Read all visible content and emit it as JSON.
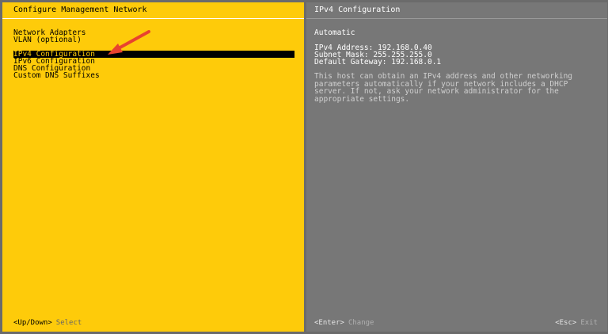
{
  "left_panel": {
    "title": "Configure Management Network",
    "menu_items": [
      {
        "label": "Network Adapters"
      },
      {
        "label": "VLAN (optional)"
      },
      {
        "label": "IPv4 Configuration"
      },
      {
        "label": "IPv6 Configuration"
      },
      {
        "label": "DNS Configuration"
      },
      {
        "label": "Custom DNS Suffixes"
      }
    ],
    "footer": {
      "key": "<Up/Down>",
      "action": "Select"
    }
  },
  "right_panel": {
    "title": "IPv4 Configuration",
    "mode": "Automatic",
    "ipv4_address": "IPv4 Address: 192.168.0.40",
    "subnet_mask": "Subnet Mask: 255.255.255.0",
    "default_gateway": "Default Gateway: 192.168.0.1",
    "description": "This host can obtain an IPv4 address and other networking\nparameters automatically if your network includes a DHCP\nserver. If not, ask your network administrator for the\nappropriate settings.",
    "footer_change": {
      "key": "<Enter>",
      "action": "Change"
    },
    "footer_exit": {
      "key": "<Esc>",
      "action": "Exit"
    }
  },
  "colors": {
    "left_bg": "#fecb0a",
    "right_bg": "#777777",
    "annotation_arrow": "#e8432f"
  },
  "icons": {
    "annotation": "arrow-pointer-icon"
  }
}
